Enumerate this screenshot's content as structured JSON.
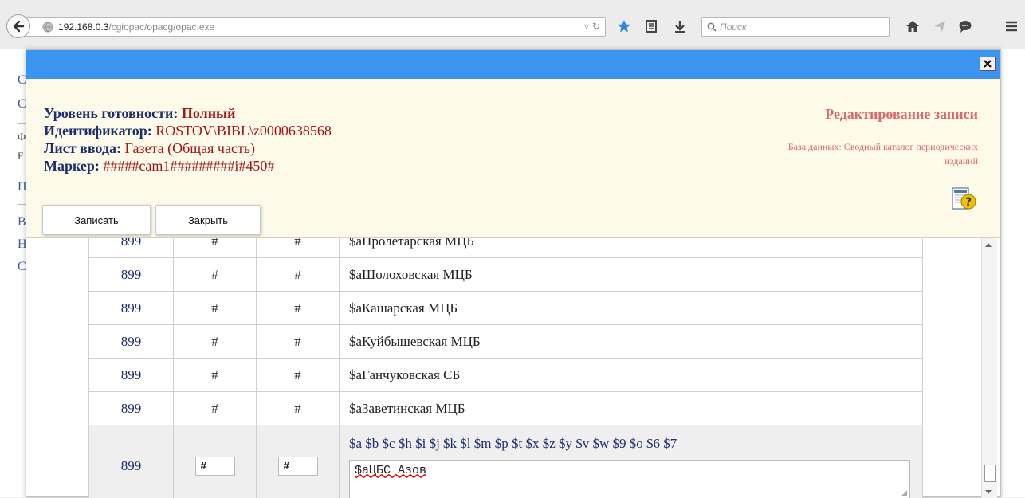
{
  "browser": {
    "url_host": "192.168.0.3",
    "url_path": "/cgiopac/opacg/opac.exe",
    "search_placeholder": "Поиск"
  },
  "background_page": {
    "chars": [
      "С",
      "С",
      "Ф",
      "F",
      "П",
      "В",
      "Н",
      "С"
    ]
  },
  "modal": {
    "info": {
      "level_label": "Уровень готовности:",
      "level_value": "Полный",
      "id_label": "Идентификатор:",
      "id_value": "ROSTOV\\BIBL\\z0000638568",
      "sheet_label": "Лист ввода:",
      "sheet_value": "Газета (Общая часть)",
      "marker_label": "Маркер:",
      "marker_value": "#####cam1#########i#450#"
    },
    "edit_title": "Редактирование записи",
    "db_label": "База данных: Сводный каталог периодических изданий",
    "buttons": {
      "save": "Записать",
      "close": "Закрыть"
    },
    "rows": [
      {
        "tag": "899",
        "ind1": "#",
        "ind2": "#",
        "value": "$aПролетарская МЦБ"
      },
      {
        "tag": "899",
        "ind1": "#",
        "ind2": "#",
        "value": "$aШолоховская МЦБ"
      },
      {
        "tag": "899",
        "ind1": "#",
        "ind2": "#",
        "value": "$aКашарская МЦБ"
      },
      {
        "tag": "899",
        "ind1": "#",
        "ind2": "#",
        "value": "$aКуйбышевская МЦБ"
      },
      {
        "tag": "899",
        "ind1": "#",
        "ind2": "#",
        "value": "$aГанчуковская СБ"
      },
      {
        "tag": "899",
        "ind1": "#",
        "ind2": "#",
        "value": "$aЗаветинская МЦБ"
      }
    ],
    "edit_row": {
      "tag": "899",
      "ind1": "#",
      "ind2": "#",
      "subfields": "$a $b $c $h $i $j $k $l $m $p $t $x $z $y $v $w $9 $o $6 $7",
      "value": "$aЦБС Азов"
    }
  }
}
